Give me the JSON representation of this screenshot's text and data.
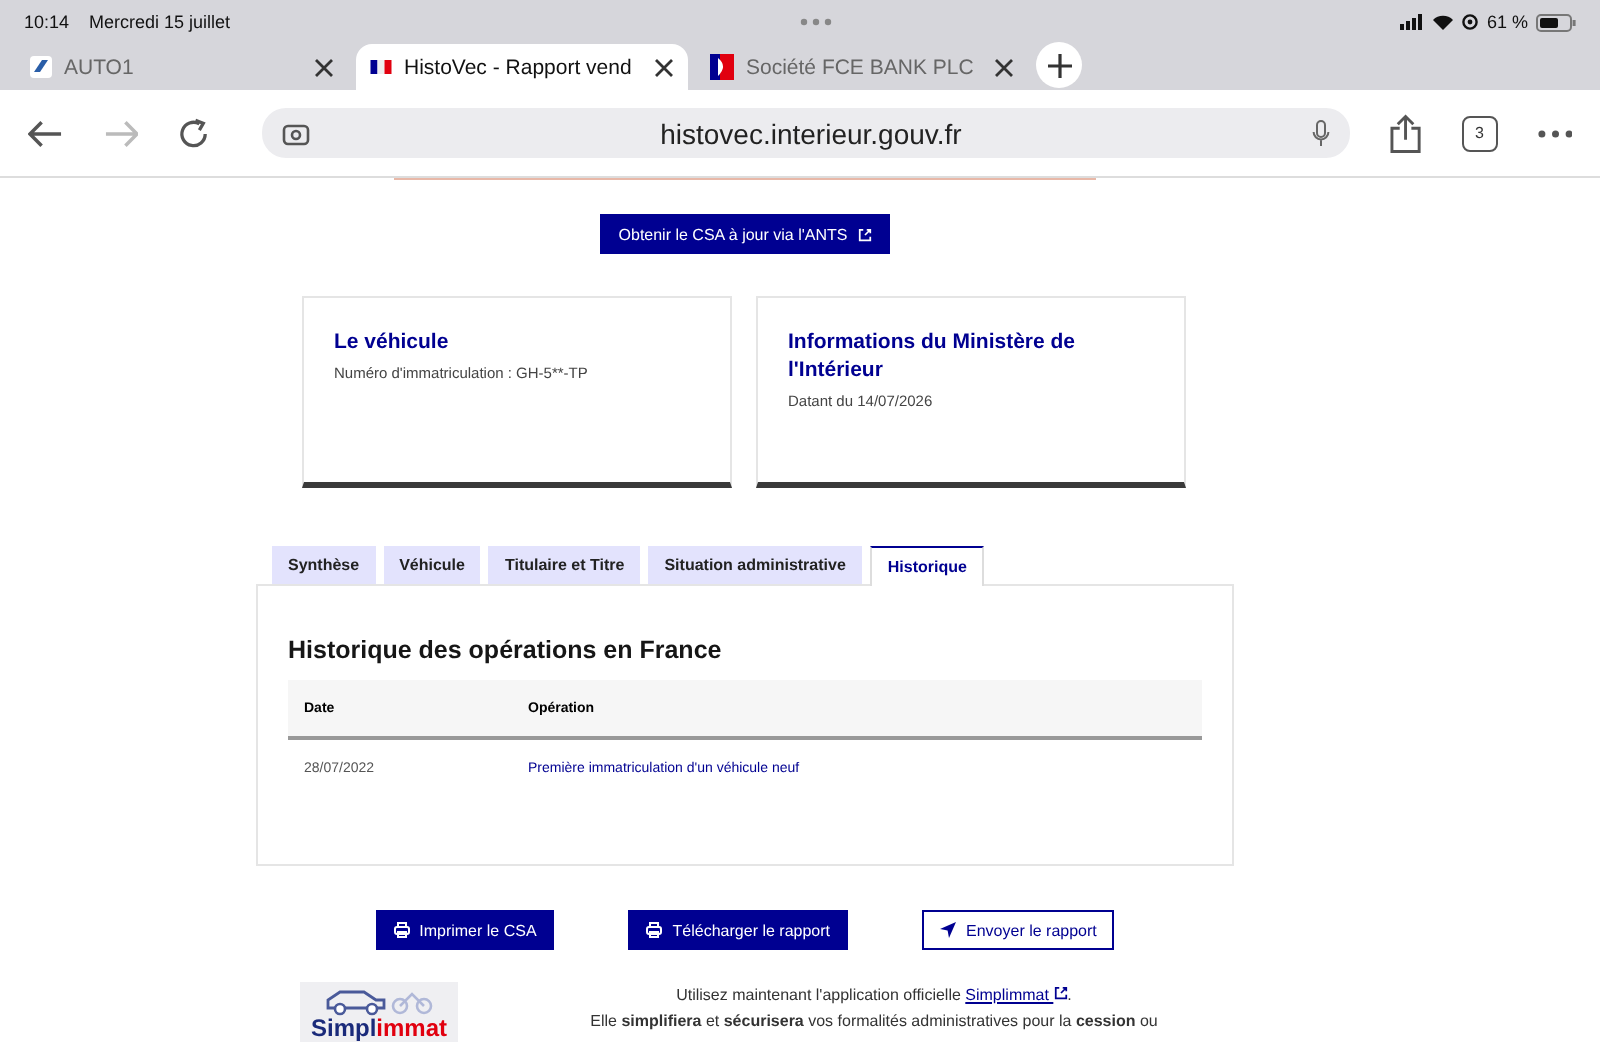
{
  "status_bar": {
    "time": "10:14",
    "date": "Mercredi 15 juillet",
    "battery": "61 %"
  },
  "browser_tabs": [
    {
      "title": "AUTO1",
      "selected": false
    },
    {
      "title": "HistoVec - Rapport vend",
      "selected": true
    },
    {
      "title": "Société FCE BANK PLC",
      "selected": false
    }
  ],
  "address_bar": {
    "url": "histovec.interieur.gouv.fr",
    "tab_count": "3"
  },
  "ants_button": "Obtenir le CSA à jour via l'ANTS",
  "cards": [
    {
      "title": "Le véhicule",
      "text": "Numéro d'immatriculation : GH-5**-TP"
    },
    {
      "title": "Informations du Ministère de l'Intérieur",
      "text": "Datant du 14/07/2026"
    }
  ],
  "tabs": [
    {
      "label": "Synthèse",
      "selected": false
    },
    {
      "label": "Véhicule",
      "selected": false
    },
    {
      "label": "Titulaire et Titre",
      "selected": false
    },
    {
      "label": "Situation administrative",
      "selected": false
    },
    {
      "label": "Historique",
      "selected": true
    }
  ],
  "history": {
    "title": "Historique des opérations en France",
    "columns": [
      "Date",
      "Opération"
    ],
    "rows": [
      {
        "date": "28/07/2022",
        "operation": "Première immatriculation d'un véhicule neuf"
      }
    ]
  },
  "actions": [
    {
      "label": "Imprimer le CSA",
      "kind": "print"
    },
    {
      "label": "Télécharger le rapport",
      "kind": "download"
    },
    {
      "label": "Envoyer le rapport",
      "kind": "send"
    }
  ],
  "promo": {
    "logo_text": "Simpl",
    "logo_accent": "immat",
    "line1": "Utilisez maintenant l'application officielle",
    "link": "Simplimmat",
    "line1_end": ".",
    "line2": "Elle **simplifiera** et **sécurisera** vos formalités administratives pour la **cession** ou"
  }
}
